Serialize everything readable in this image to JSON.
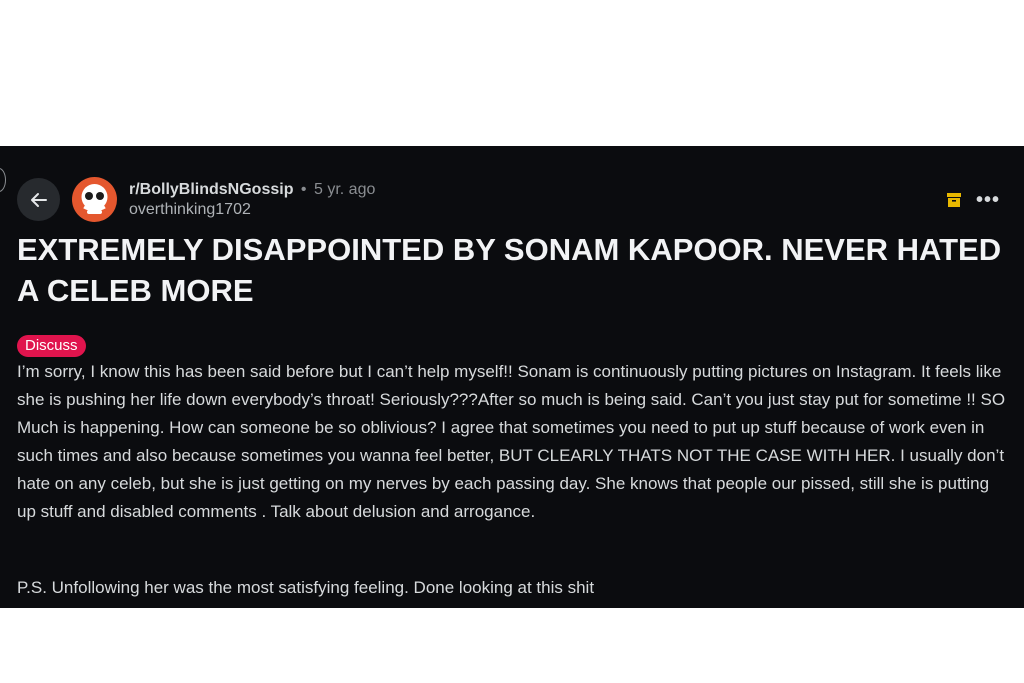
{
  "post": {
    "subreddit": "r/BollyBlindsNGossip",
    "separator": "•",
    "age": "5 yr. ago",
    "author": "overthinking1702",
    "title": "EXTREMELY DISAPPOINTED BY SONAM KAPOOR. NEVER HATED A CELEB MORE",
    "flair": "Discuss",
    "body": "I’m sorry, I know this has been said before but I can’t help myself!! Sonam is continuously putting pictures on Instagram. It feels like she is pushing her life down everybody’s throat! Seriously???After so much is being said. Can’t you just stay put for sometime !! SO Much is happening. How can someone be so oblivious? I agree that sometimes you need to put up stuff because of work even in such times and also because sometimes you wanna feel better, BUT CLEARLY THATS NOT THE CASE WITH HER. I usually don’t hate on any celeb, but she is just getting on my nerves by each passing day. She knows that people our pissed, still she is putting up stuff and disabled comments . Talk about delusion and arrogance.",
    "ps": "P.S. Unfollowing her was the most satisfying feeling. Done looking at this shit"
  },
  "icons": {
    "back": "arrow-left-icon",
    "archive": "archive-icon",
    "more": "more-options-icon",
    "more_glyph": "•••"
  },
  "colors": {
    "background": "#0b0c0f",
    "flair": "#e0144d",
    "archive": "#e8b800",
    "avatar": "#e4572e"
  }
}
